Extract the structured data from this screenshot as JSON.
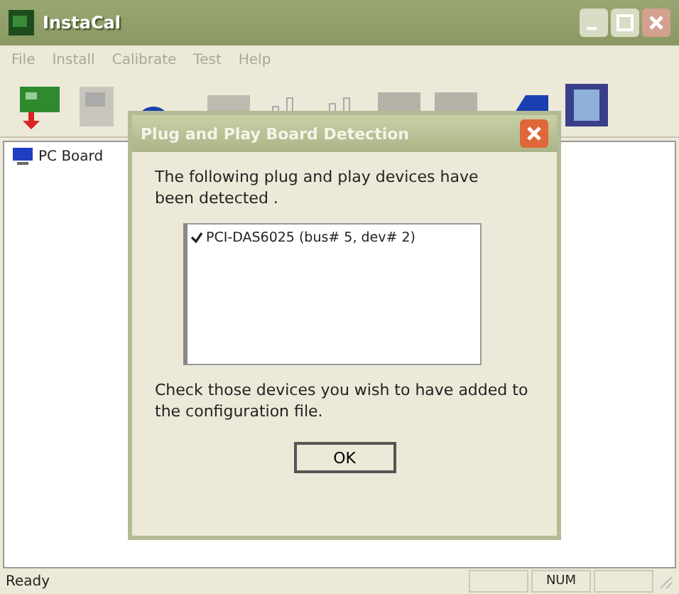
{
  "window": {
    "title": "InstaCal"
  },
  "menu": [
    "File",
    "Install",
    "Calibrate",
    "Test",
    "Help"
  ],
  "tree": {
    "items": [
      {
        "label": "PC Board"
      }
    ]
  },
  "dialog": {
    "title": "Plug and Play Board Detection",
    "message": "The following plug and play devices have been detected .",
    "devices": [
      {
        "label": "PCI-DAS6025 (bus# 5, dev# 2)",
        "checked": true
      }
    ],
    "instructions": "Check those devices you wish to have added to the configuration file.",
    "buttons": [
      "OK"
    ]
  },
  "status_bar": {
    "message": "Ready",
    "indicators": [
      "NUM"
    ]
  }
}
